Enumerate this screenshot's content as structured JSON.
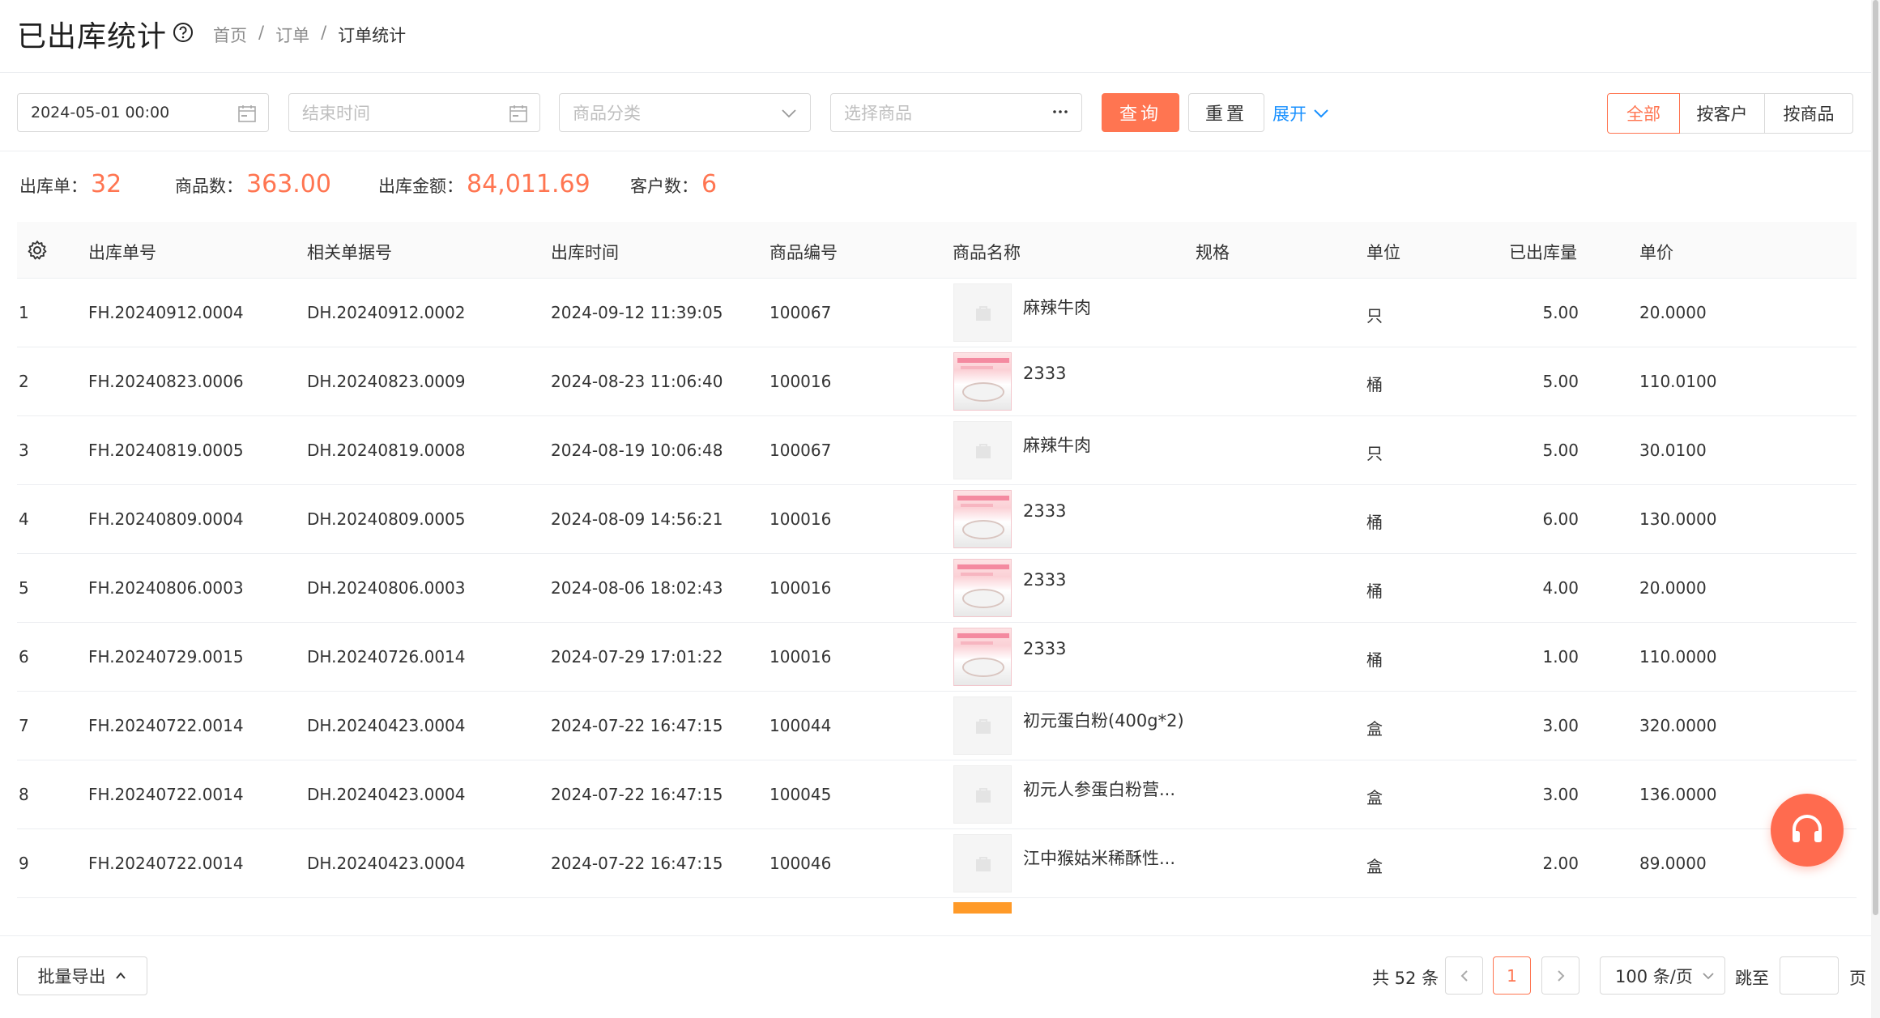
{
  "header": {
    "title": "已出库统计",
    "breadcrumb": [
      "首页",
      "订单",
      "订单统计"
    ],
    "breadcrumb_sep": "/"
  },
  "filters": {
    "start_time_value": "2024-05-01 00:00",
    "end_time_placeholder": "结束时间",
    "category_placeholder": "商品分类",
    "product_placeholder": "选择商品",
    "query_label": "查询",
    "reset_label": "重置",
    "expand_label": "展开",
    "view_tabs": [
      "全部",
      "按客户",
      "按商品"
    ],
    "active_view": "全部"
  },
  "summary": [
    {
      "label": "出库单：",
      "value": "32"
    },
    {
      "label": "商品数：",
      "value": "363.00"
    },
    {
      "label": "出库金额：",
      "value": "84,011.69"
    },
    {
      "label": "客户数：",
      "value": "6"
    }
  ],
  "table": {
    "columns": [
      "出库单号",
      "相关单据号",
      "出库时间",
      "商品编号",
      "商品名称",
      "规格",
      "单位",
      "已出库量",
      "单价"
    ],
    "rows": [
      {
        "idx": "1",
        "out_no": "FH.20240912.0004",
        "ref_no": "DH.20240912.0002",
        "time": "2024-09-12 11:39:05",
        "code": "100067",
        "name": "麻辣牛肉",
        "spec": "",
        "unit": "只",
        "qty": "5.00",
        "price": "20.0000",
        "photo": false
      },
      {
        "idx": "2",
        "out_no": "FH.20240823.0006",
        "ref_no": "DH.20240823.0009",
        "time": "2024-08-23 11:06:40",
        "code": "100016",
        "name": "2333",
        "spec": "",
        "unit": "桶",
        "qty": "5.00",
        "price": "110.0100",
        "photo": true
      },
      {
        "idx": "3",
        "out_no": "FH.20240819.0005",
        "ref_no": "DH.20240819.0008",
        "time": "2024-08-19 10:06:48",
        "code": "100067",
        "name": "麻辣牛肉",
        "spec": "",
        "unit": "只",
        "qty": "5.00",
        "price": "30.0100",
        "photo": false
      },
      {
        "idx": "4",
        "out_no": "FH.20240809.0004",
        "ref_no": "DH.20240809.0005",
        "time": "2024-08-09 14:56:21",
        "code": "100016",
        "name": "2333",
        "spec": "",
        "unit": "桶",
        "qty": "6.00",
        "price": "130.0000",
        "photo": true
      },
      {
        "idx": "5",
        "out_no": "FH.20240806.0003",
        "ref_no": "DH.20240806.0003",
        "time": "2024-08-06 18:02:43",
        "code": "100016",
        "name": "2333",
        "spec": "",
        "unit": "桶",
        "qty": "4.00",
        "price": "20.0000",
        "photo": true
      },
      {
        "idx": "6",
        "out_no": "FH.20240729.0015",
        "ref_no": "DH.20240726.0014",
        "time": "2024-07-29 17:01:22",
        "code": "100016",
        "name": "2333",
        "spec": "",
        "unit": "桶",
        "qty": "1.00",
        "price": "110.0000",
        "photo": true
      },
      {
        "idx": "7",
        "out_no": "FH.20240722.0014",
        "ref_no": "DH.20240423.0004",
        "time": "2024-07-22 16:47:15",
        "code": "100044",
        "name": "初元蛋白粉(400g*2)",
        "spec": "",
        "unit": "盒",
        "qty": "3.00",
        "price": "320.0000",
        "photo": false
      },
      {
        "idx": "8",
        "out_no": "FH.20240722.0014",
        "ref_no": "DH.20240423.0004",
        "time": "2024-07-22 16:47:15",
        "code": "100045",
        "name": "初元人参蛋白粉营...",
        "spec": "",
        "unit": "盒",
        "qty": "3.00",
        "price": "136.0000",
        "photo": false
      },
      {
        "idx": "9",
        "out_no": "FH.20240722.0014",
        "ref_no": "DH.20240423.0004",
        "time": "2024-07-22 16:47:15",
        "code": "100046",
        "name": "江中猴姑米稀酥性...",
        "spec": "",
        "unit": "盒",
        "qty": "2.00",
        "price": "89.0000",
        "photo": false
      }
    ]
  },
  "footer": {
    "export_label": "批量导出",
    "total_label": "共 52 条",
    "current_page": "1",
    "page_size": "100 条/页",
    "jump_label": "跳至",
    "page_unit": "页"
  },
  "colors": {
    "accent": "#ff7551",
    "link": "#1890ff"
  }
}
